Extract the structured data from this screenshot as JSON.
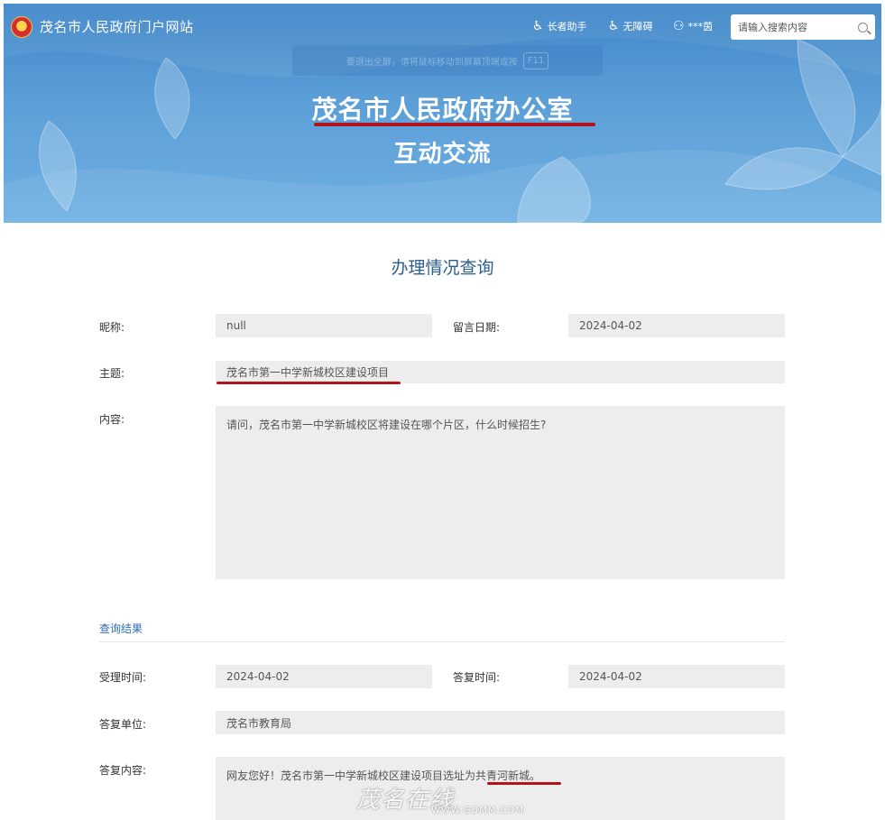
{
  "header": {
    "site_name": "茂名市人民政府门户网站",
    "elder_helper": "长者助手",
    "accessibility": "无障碍",
    "user": "***茵",
    "search_placeholder": "请输入搜索内容",
    "fullscreen_hint": "要退出全屏，请将鼠标移动到屏幕顶端或按",
    "fullscreen_key": "F11",
    "title_main": "茂名市人民政府办公室",
    "title_sub": "互动交流"
  },
  "page": {
    "section_title": "办理情况查询"
  },
  "message": {
    "nickname_label": "昵称:",
    "nickname": "null",
    "date_label": "留言日期:",
    "date": "2024-04-02",
    "subject_label": "主题:",
    "subject": "茂名市第一中学新城校区建设项目",
    "content_label": "内容:",
    "content": "请问，茂名市第一中学新城校区将建设在哪个片区，什么时候招生?"
  },
  "result": {
    "heading": "查询结果",
    "accepted_label": "受理时间:",
    "accepted": "2024-04-02",
    "reply_time_label": "答复时间:",
    "reply_time": "2024-04-02",
    "unit_label": "答复单位:",
    "unit": "茂名市教育局",
    "reply_label": "答复内容:",
    "reply": "网友您好！茂名市第一中学新城校区建设项目选址为共青河新城。"
  },
  "watermark": {
    "text": "茂名在线",
    "url": "WWW.GDMM.COM"
  },
  "colors": {
    "banner": "#4a92d2",
    "accent_text": "#2b5e8f",
    "underline_red": "#b3131c",
    "field_bg": "#ededed"
  }
}
